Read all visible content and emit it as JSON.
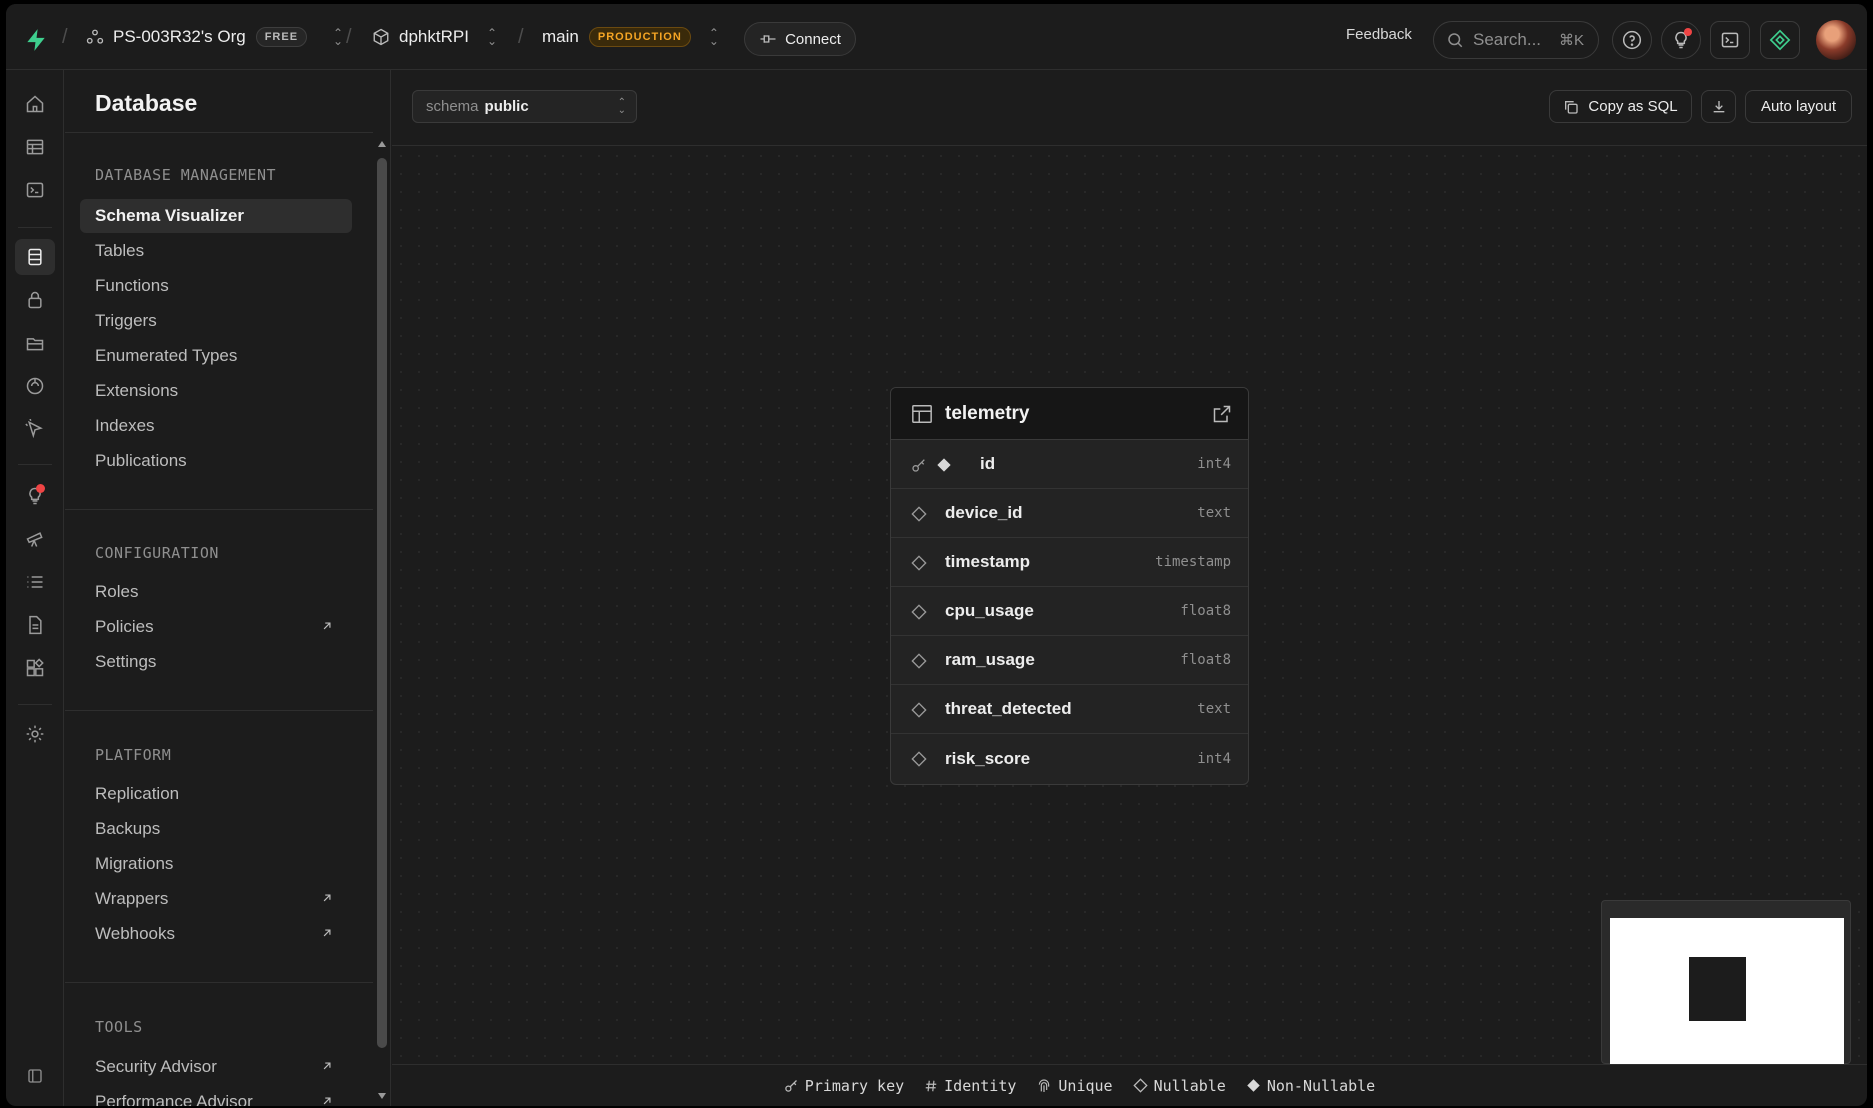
{
  "topbar": {
    "org_name": "PS-003R32's Org",
    "org_badge": "FREE",
    "project_name": "dphktRPI",
    "branch_name": "main",
    "branch_badge": "PRODUCTION",
    "connect_label": "Connect",
    "feedback_label": "Feedback",
    "search_placeholder": "Search...",
    "search_shortcut": "⌘K"
  },
  "sidebar": {
    "title": "Database",
    "sections": [
      {
        "label": "DATABASE MANAGEMENT",
        "items": [
          {
            "label": "Schema Visualizer",
            "active": true
          },
          {
            "label": "Tables"
          },
          {
            "label": "Functions"
          },
          {
            "label": "Triggers"
          },
          {
            "label": "Enumerated Types"
          },
          {
            "label": "Extensions"
          },
          {
            "label": "Indexes"
          },
          {
            "label": "Publications"
          }
        ]
      },
      {
        "label": "CONFIGURATION",
        "items": [
          {
            "label": "Roles"
          },
          {
            "label": "Policies",
            "external": true
          },
          {
            "label": "Settings"
          }
        ]
      },
      {
        "label": "PLATFORM",
        "items": [
          {
            "label": "Replication"
          },
          {
            "label": "Backups"
          },
          {
            "label": "Migrations"
          },
          {
            "label": "Wrappers",
            "external": true
          },
          {
            "label": "Webhooks",
            "external": true
          }
        ]
      },
      {
        "label": "TOOLS",
        "items": [
          {
            "label": "Security Advisor",
            "external": true
          },
          {
            "label": "Performance Advisor",
            "external": true
          }
        ]
      }
    ]
  },
  "toolbar": {
    "schema_prefix": "schema",
    "schema_value": "public",
    "copy_sql_label": "Copy as SQL",
    "auto_layout_label": "Auto layout"
  },
  "table_node": {
    "name": "telemetry",
    "columns": [
      {
        "name": "id",
        "type": "int4",
        "primary": true
      },
      {
        "name": "device_id",
        "type": "text"
      },
      {
        "name": "timestamp",
        "type": "timestamp"
      },
      {
        "name": "cpu_usage",
        "type": "float8"
      },
      {
        "name": "ram_usage",
        "type": "float8"
      },
      {
        "name": "threat_detected",
        "type": "text"
      },
      {
        "name": "risk_score",
        "type": "int4"
      }
    ]
  },
  "legend": {
    "primary_key": "Primary key",
    "identity": "Identity",
    "unique": "Unique",
    "nullable": "Nullable",
    "non_nullable": "Non-Nullable"
  },
  "colors": {
    "brand": "#3ecf8e",
    "background": "#1c1c1c",
    "border": "#2e2e2e",
    "production_badge": "#f5a524",
    "notification_dot": "#ef4444"
  }
}
